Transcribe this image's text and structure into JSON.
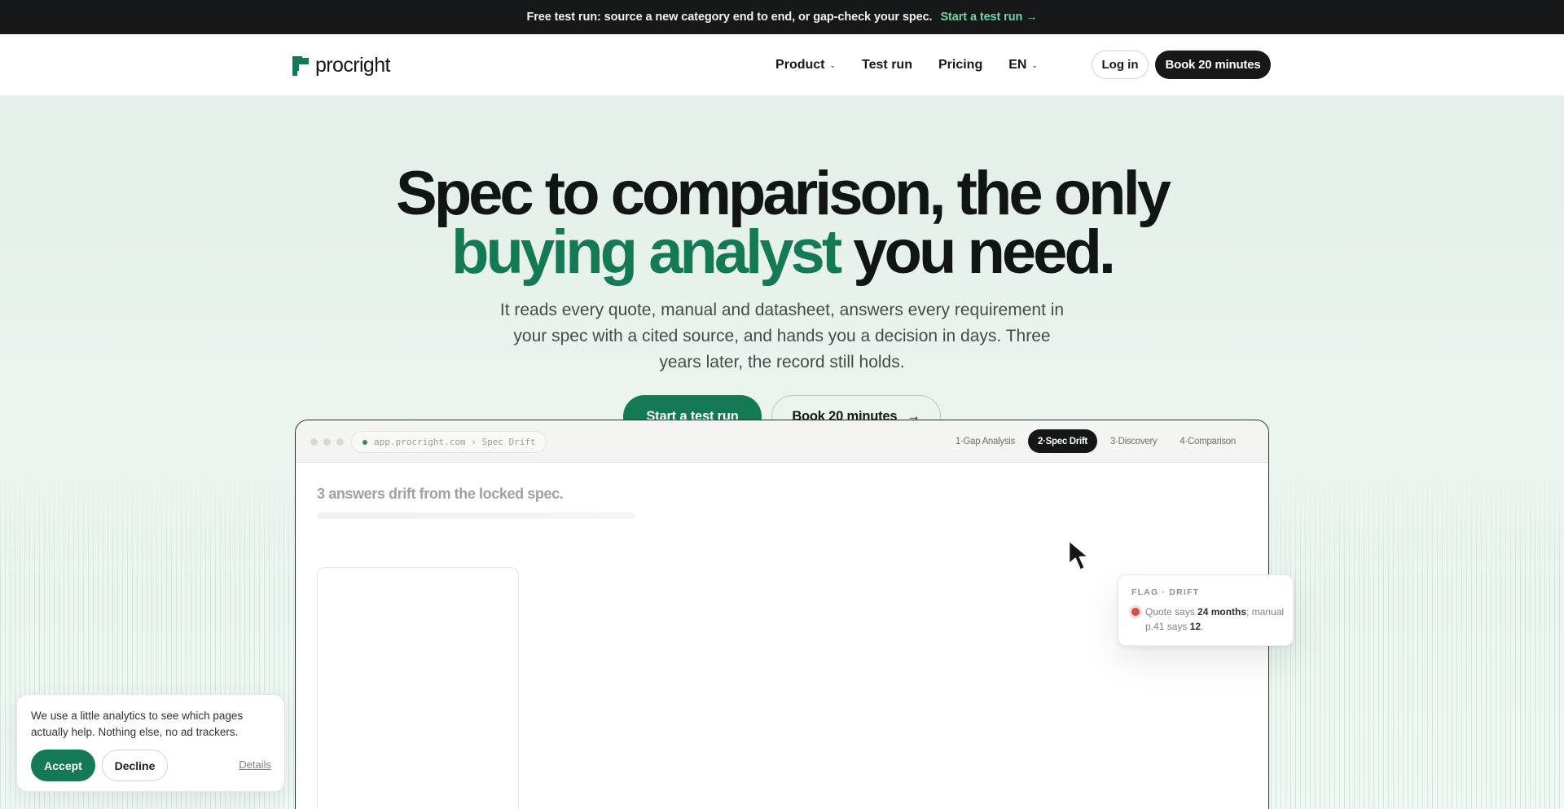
{
  "announcement": {
    "text": "Free test run: source a new category end to end, or gap-check your spec.",
    "cta": "Start a test run →"
  },
  "nav": {
    "logo_text": "procright",
    "items": [
      {
        "label": "Product",
        "has_dropdown": true
      },
      {
        "label": "Test run",
        "has_dropdown": false
      },
      {
        "label": "Pricing",
        "has_dropdown": false
      },
      {
        "label": "EN",
        "has_dropdown": true
      }
    ],
    "login": "Log in",
    "book": "Book 20 minutes"
  },
  "hero": {
    "headline_line1": "Spec to comparison, the only",
    "headline_green": "buying analyst",
    "headline_rest": " you need.",
    "subhead": "It reads every quote, manual and datasheet, answers every requirement in your spec with a cited source, and hands you a decision in days. Three years later, the record still holds.",
    "primary_cta": "Start a test run",
    "secondary_cta": "Book 20 minutes",
    "secondary_arrow": "→"
  },
  "app": {
    "url": "app.procright.com › Spec Drift",
    "steps": [
      {
        "label": "1·Gap Analysis",
        "active": false
      },
      {
        "label": "2·Spec Drift",
        "active": true
      },
      {
        "label": "3·Discovery",
        "active": false
      },
      {
        "label": "4·Comparison",
        "active": false
      }
    ],
    "title": "3 answers drift from the locked spec."
  },
  "flag": {
    "label": "FLAG · DRIFT",
    "text_a": "Quote says ",
    "text_b": "24 months",
    "text_c": "; manual p.41 says ",
    "text_d": "12",
    "text_e": "."
  },
  "cookie": {
    "text": "We use a little analytics to see which pages actually help. Nothing else, no ad trackers.",
    "accept": "Accept",
    "decline": "Decline",
    "details": "Details"
  },
  "colors": {
    "brand_green": "#137a55",
    "dark": "#16181a",
    "announce_cta": "#6fd6a5",
    "flag_red": "#d84c4c"
  }
}
